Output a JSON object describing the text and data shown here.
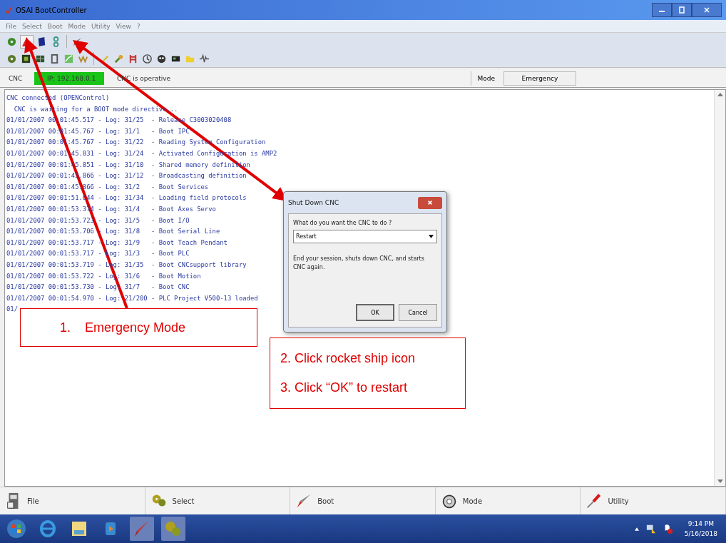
{
  "window": {
    "title": "OSAI BootController"
  },
  "menu": [
    "File",
    "Select",
    "Boot",
    "Mode",
    "Utility",
    "View",
    "?"
  ],
  "status": {
    "label": "CNC",
    "ip": "IP: 192.168.0.1",
    "state": "CNC is operative",
    "mode_label": "Mode",
    "mode_value": "Emergency"
  },
  "log": [
    "CNC connected (OPENControl)",
    "  CNC is waiting for a BOOT mode directive...",
    "01/01/2007 00:01:45.517 - Log: 31/25  - Release C3003020408",
    "01/01/2007 00:01:45.767 - Log: 31/1   - Boot IPC",
    "01/01/2007 00:01:45.767 - Log: 31/22  - Reading System Configuration",
    "01/01/2007 00:01:45.831 - Log: 31/24  - Activated Configuration is AMP2",
    "01/01/2007 00:01:45.851 - Log: 31/10  - Shared memory definition",
    "01/01/2007 00:01:45.866 - Log: 31/12  - Broadcasting definition",
    "01/01/2007 00:01:45.866 - Log: 31/2   - Boot Services",
    "01/01/2007 00:01:51.644 - Log: 31/34  - Loading field protocols",
    "01/01/2007 00:01:53.374 - Log: 31/4   - Boot Axes Servo",
    "01/01/2007 00:01:53.723 - Log: 31/5   - Boot I/O",
    "01/01/2007 00:01:53.706 - Log: 31/8   - Boot Serial Line",
    "01/01/2007 00:01:53.717 - Log: 31/9   - Boot Teach Pendant",
    "01/01/2007 00:01:53.717 - Log: 31/3   - Boot PLC",
    "01/01/2007 00:01:53.719 - Log: 31/35  - Boot CNCsupport library",
    "01/01/2007 00:01:53.722 - Log: 31/6   - Boot Motion",
    "01/01/2007 00:01:53.730 - Log: 31/7   - Boot CNC",
    "01/01/2007 00:01:54.970 - Log: 21/200 - PLC Project V500-13 loaded",
    "01/"
  ],
  "dialog": {
    "title": "Shut Down CNC",
    "prompt": "What do you want the CNC to do ?",
    "value": "Restart",
    "description": "End your session, shuts down CNC, and starts CNC again.",
    "buttons": [
      "OK",
      "Cancel"
    ]
  },
  "bottom_bar": [
    {
      "kind": "file",
      "label": "File"
    },
    {
      "kind": "select",
      "label": "Select"
    },
    {
      "kind": "boot",
      "label": "Boot"
    },
    {
      "kind": "mode",
      "label": "Mode"
    },
    {
      "kind": "utility",
      "label": "Utility"
    }
  ],
  "taskbar": {
    "time": "9:14 PM",
    "date": "5/16/2018"
  },
  "annotations": [
    {
      "lines": [
        "1.    Emergency Mode"
      ]
    },
    {
      "lines": [
        "2. Click rocket ship icon",
        "3. Click “OK” to restart"
      ]
    }
  ]
}
